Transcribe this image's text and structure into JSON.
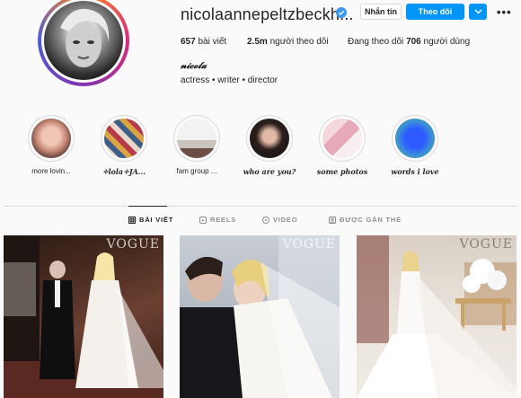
{
  "profile": {
    "username": "nicolaannepeltzbeckh...",
    "message_label": "Nhắn tin",
    "following_label": "Theo dõi",
    "dropdown_glyph": "⌄",
    "more_glyph": "•••",
    "stats": {
      "posts_count": "657",
      "posts_label": "bài viết",
      "followers_count": "2.5m",
      "followers_label": "người theo dõi",
      "following_prefix": "Đang theo dõi",
      "following_count": "706",
      "following_suffix": "người dùng"
    },
    "full_name": "𝓷𝓲𝓬𝓸𝓵𝓪",
    "bio": "actress • writer • director"
  },
  "highlights": [
    {
      "label": "more lovin...",
      "icon": "highlight-face"
    },
    {
      "label": "✧lola✧JA...",
      "icon": "highlight-collage"
    },
    {
      "label": "fam group ...",
      "icon": "highlight-group"
    },
    {
      "label": "who are you?",
      "icon": "highlight-selfie"
    },
    {
      "label": "some photos",
      "icon": "highlight-photos"
    },
    {
      "label": "words i love",
      "icon": "highlight-gradient"
    }
  ],
  "tabs": [
    {
      "label": "BÀI VIẾT",
      "icon": "grid-icon",
      "active": true
    },
    {
      "label": "REELS",
      "icon": "reels-icon",
      "active": false
    },
    {
      "label": "VIDEO",
      "icon": "video-icon",
      "active": false
    },
    {
      "label": "ĐƯỢC GẮN THẺ",
      "icon": "tagged-icon",
      "active": false
    }
  ],
  "posts": [
    {
      "overlay_text": "VOGUE"
    },
    {
      "overlay_text": "VOGUE"
    },
    {
      "overlay_text": "VOGUE"
    }
  ],
  "colors": {
    "accent": "#0095f6",
    "verified": "#3897f0",
    "text": "#262626",
    "muted": "#8e8e8e",
    "border": "#dbdbdb"
  }
}
